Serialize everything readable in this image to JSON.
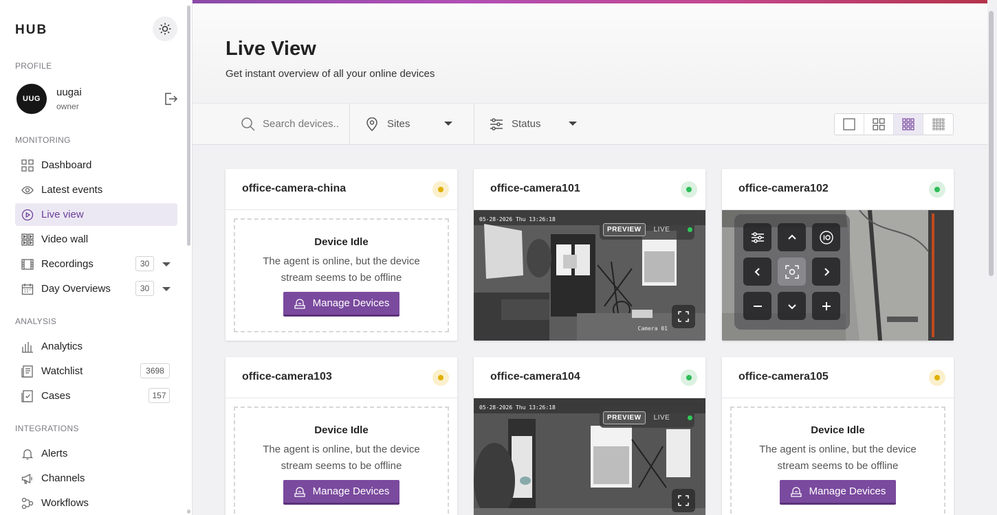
{
  "sidebar": {
    "brand": "HUB",
    "profile_label": "PROFILE",
    "user": {
      "initials": "UUG",
      "name": "uugai",
      "role": "owner"
    },
    "monitoring_label": "MONITORING",
    "monitoring": [
      {
        "label": "Dashboard",
        "icon": "grid-icon"
      },
      {
        "label": "Latest events",
        "icon": "eye-icon"
      },
      {
        "label": "Live view",
        "icon": "play-circle-icon",
        "active": true
      },
      {
        "label": "Video wall",
        "icon": "video-wall-icon"
      },
      {
        "label": "Recordings",
        "icon": "film-icon",
        "count": "30"
      },
      {
        "label": "Day Overviews",
        "icon": "calendar-icon",
        "count": "30"
      }
    ],
    "analysis_label": "ANALYSIS",
    "analysis": [
      {
        "label": "Analytics",
        "icon": "bar-chart-icon"
      },
      {
        "label": "Watchlist",
        "icon": "document-icon",
        "count": "3698"
      },
      {
        "label": "Cases",
        "icon": "checklist-icon",
        "count": "157"
      }
    ],
    "integrations_label": "INTEGRATIONS",
    "integrations": [
      {
        "label": "Alerts",
        "icon": "bell-icon"
      },
      {
        "label": "Channels",
        "icon": "megaphone-icon"
      },
      {
        "label": "Workflows",
        "icon": "workflow-icon"
      }
    ]
  },
  "header": {
    "title": "Live View",
    "subtitle": "Get instant overview of all your online devices"
  },
  "filters": {
    "search_placeholder": "Search devices..",
    "sites": "Sites",
    "status": "Status"
  },
  "colors": {
    "accent": "#7a4a9e",
    "idle": "#e0b000",
    "online": "#2ebd59"
  },
  "cameras": [
    {
      "name": "office-camera-china",
      "state": "idle"
    },
    {
      "name": "office-camera101",
      "state": "live",
      "timestamp": "05-28-2026 Thu 13:26:18",
      "label": "Camera 01"
    },
    {
      "name": "office-camera102",
      "state": "live-ptz"
    },
    {
      "name": "office-camera103",
      "state": "idle"
    },
    {
      "name": "office-camera104",
      "state": "live",
      "timestamp": "05-28-2026 Thu 13:26:18"
    },
    {
      "name": "office-camera105",
      "state": "idle"
    }
  ],
  "idle": {
    "title": "Device Idle",
    "text": "The agent is online, but the device stream seems to be offline",
    "button": "Manage Devices"
  },
  "video": {
    "preview": "PREVIEW",
    "live": "LIVE"
  }
}
